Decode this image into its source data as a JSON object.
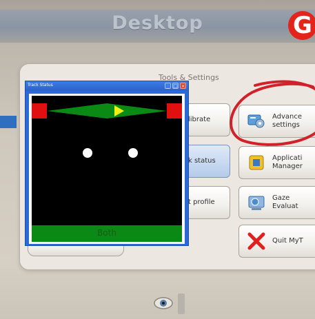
{
  "desktop": {
    "title": "Desktop",
    "badge": "G"
  },
  "panel": {
    "title": "Tools & Settings"
  },
  "left_buttons": {
    "calibrate": "librate",
    "track_status": "k status",
    "profile": "t profile"
  },
  "right_buttons": {
    "advanced_line1": "Advance",
    "advanced_line2": "settings",
    "appmgr_line1": "Applicati",
    "appmgr_line2": "Manager",
    "gaze_line1": "Gaze",
    "gaze_line2": "Evaluat",
    "quit": "Quit MyT"
  },
  "track_window": {
    "title": "Track Status",
    "status_label": "Both"
  },
  "colors": {
    "annotation": "#d0222a",
    "badge": "#e3241c",
    "track_green": "#0a8a14",
    "corner_red": "#e01010"
  },
  "icons": [
    "eye-icon",
    "advanced-settings-icon",
    "application-manager-icon",
    "gaze-evaluation-icon",
    "quit-x-icon"
  ]
}
